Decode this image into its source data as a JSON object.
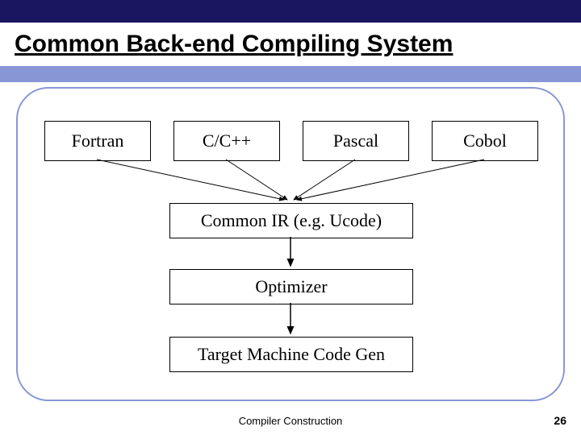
{
  "title": "Common Back-end Compiling System",
  "langs": [
    "Fortran",
    "C/C++",
    "Pascal",
    "Cobol"
  ],
  "stages": {
    "ir": "Common IR (e.g. Ucode)",
    "opt": "Optimizer",
    "codegen": "Target Machine Code Gen"
  },
  "footer": "Compiler Construction",
  "page": "26"
}
